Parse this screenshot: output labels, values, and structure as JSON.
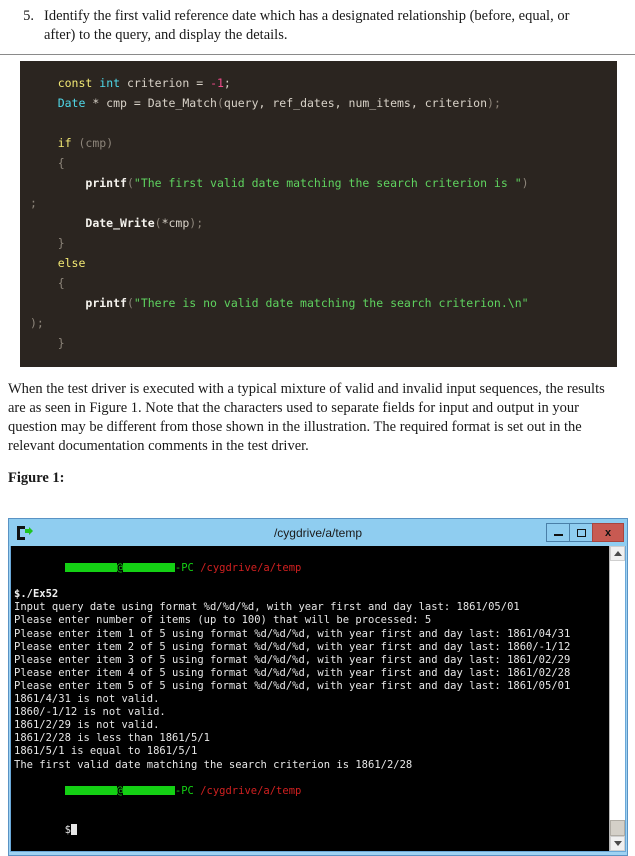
{
  "list_item": {
    "number": "5.",
    "text": "Identify the first valid reference date which has a designated relationship (before, equal, or after) to the query, and display the details."
  },
  "code": {
    "lines": [
      [
        {
          "t": "const",
          "c": "kw"
        },
        {
          "t": " ",
          "c": "plain"
        },
        {
          "t": "int",
          "c": "type"
        },
        {
          "t": " criterion = ",
          "c": "plain"
        },
        {
          "t": "-1",
          "c": "num"
        },
        {
          "t": ";",
          "c": "plain"
        }
      ],
      [
        {
          "t": "Date",
          "c": "type"
        },
        {
          "t": " * cmp = Date_Match",
          "c": "plain"
        },
        {
          "t": "(",
          "c": "punct"
        },
        {
          "t": "query, ref_dates, num_items, criterion",
          "c": "plain"
        },
        {
          "t": ");",
          "c": "punct"
        }
      ],
      [],
      [
        {
          "t": "if",
          "c": "kw"
        },
        {
          "t": " ",
          "c": "plain"
        },
        {
          "t": "(cmp)",
          "c": "punct"
        }
      ],
      [
        {
          "t": "{",
          "c": "punct"
        }
      ],
      [
        {
          "t": "    printf",
          "c": "fn"
        },
        {
          "t": "(",
          "c": "punct"
        },
        {
          "t": "\"The first valid date matching the search criterion is \"",
          "c": "str"
        },
        {
          "t": ")",
          "c": "punct"
        }
      ],
      [
        {
          "t": ";",
          "c": "punct"
        }
      ],
      [
        {
          "t": "    Date_Write",
          "c": "fn"
        },
        {
          "t": "(",
          "c": "punct"
        },
        {
          "t": "*cmp",
          "c": "plain"
        },
        {
          "t": ");",
          "c": "punct"
        }
      ],
      [
        {
          "t": "}",
          "c": "punct"
        }
      ],
      [
        {
          "t": "else",
          "c": "kw"
        }
      ],
      [
        {
          "t": "{",
          "c": "punct"
        }
      ],
      [
        {
          "t": "    printf",
          "c": "fn"
        },
        {
          "t": "(",
          "c": "punct"
        },
        {
          "t": "\"There is no valid date matching the search criterion.\\n\"",
          "c": "str"
        }
      ],
      [
        {
          "t": ");",
          "c": "punct"
        }
      ],
      [
        {
          "t": "}",
          "c": "punct"
        }
      ]
    ],
    "indent": "    "
  },
  "paragraph": "When the test driver is executed with a typical mixture of valid and invalid input sequences, the results are as seen in Figure 1. Note that the characters used to separate fields for input and output in your question may be different from those shown in the illustration. The required format is set out in the relevant documentation comments in the test driver.",
  "figure_label": "Figure 1:",
  "terminal": {
    "title": "/cygdrive/a/temp",
    "icon": "cygwin-icon",
    "buttons": {
      "minimize": "minimize-button",
      "maximize": "maximize-button",
      "close": "x"
    },
    "prompt_host": "-PC",
    "prompt_path": "/cygdrive/a/temp",
    "prompt_symbol": "$",
    "lines": [
      "$./Ex52",
      "Input query date using format %d/%d/%d, with year first and day last: 1861/05/01",
      "Please enter number of items (up to 100) that will be processed: 5",
      "Please enter item 1 of 5 using format %d/%d/%d, with year first and day last: 1861/04/31",
      "Please enter item 2 of 5 using format %d/%d/%d, with year first and day last: 1860/-1/12",
      "Please enter item 3 of 5 using format %d/%d/%d, with year first and day last: 1861/02/29",
      "Please enter item 4 of 5 using format %d/%d/%d, with year first and day last: 1861/02/28",
      "Please enter item 5 of 5 using format %d/%d/%d, with year first and day last: 1861/05/01",
      "1861/4/31 is not valid.",
      "1860/-1/12 is not valid.",
      "1861/2/29 is not valid.",
      "1861/2/28 is less than 1861/5/1",
      "1861/5/1 is equal to 1861/5/1",
      "The first valid date matching the search criterion is 1861/2/28"
    ],
    "colors": {
      "title_bar": "#8fcdf0",
      "close_button": "#c85a52",
      "prompt_user": "#14d014",
      "prompt_path_color": "#d02020",
      "screen_bg": "#000000",
      "screen_fg": "#e6e6e6"
    }
  },
  "code_colors": {
    "background": "#2b2520",
    "keyword": "#f2e873",
    "type": "#4fd8e8",
    "number": "#f04a8a",
    "string": "#5fd35f",
    "plain": "#d8d2c8"
  }
}
